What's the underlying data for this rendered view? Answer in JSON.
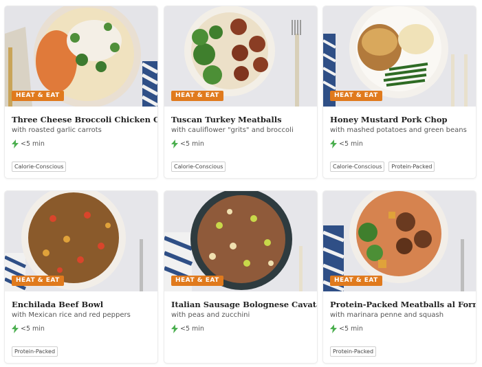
{
  "meals": [
    {
      "badge": "HEAT & EAT",
      "title": "Three Cheese Broccoli Chicken Orzo",
      "subtitle": "with roasted garlic carrots",
      "time": "<5 min",
      "tags": [
        "Calorie-Conscious"
      ],
      "icon": "lightning-icon"
    },
    {
      "badge": "HEAT & EAT",
      "title": "Tuscan Turkey Meatballs",
      "subtitle": "with cauliflower \"grits\" and broccoli",
      "time": "<5 min",
      "tags": [
        "Calorie-Conscious"
      ],
      "icon": "lightning-icon"
    },
    {
      "badge": "HEAT & EAT",
      "title": "Honey Mustard Pork Chop",
      "subtitle": "with mashed potatoes and green beans",
      "time": "<5 min",
      "tags": [
        "Calorie-Conscious",
        "Protein-Packed"
      ],
      "icon": "lightning-icon"
    },
    {
      "badge": "HEAT & EAT",
      "title": "Enchilada Beef Bowl",
      "subtitle": "with Mexican rice and red peppers",
      "time": "<5 min",
      "tags": [
        "Protein-Packed"
      ],
      "icon": "lightning-icon"
    },
    {
      "badge": "HEAT & EAT",
      "title": "Italian Sausage Bolognese Cavatappi",
      "subtitle": "with peas and zucchini",
      "time": "<5 min",
      "tags": [],
      "icon": "lightning-icon"
    },
    {
      "badge": "HEAT & EAT",
      "title": "Protein-Packed Meatballs al Forno",
      "subtitle": "with marinara penne and squash",
      "time": "<5 min",
      "tags": [
        "Protein-Packed"
      ],
      "icon": "lightning-icon"
    }
  ],
  "colors": {
    "badge": "#e07a1d",
    "lightning": "#4caf50",
    "countertop": "#e6e6ea",
    "plate": "#f7f4ef"
  }
}
